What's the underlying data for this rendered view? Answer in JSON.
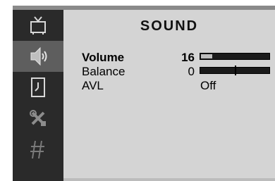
{
  "menu": {
    "title": "SOUND",
    "icons": [
      "tv-icon",
      "speaker-icon",
      "clock-icon",
      "tools-icon",
      "antenna-icon"
    ],
    "active_icon_index": 1
  },
  "settings": {
    "volume": {
      "label": "Volume",
      "value": "16",
      "level_fraction": 0.16
    },
    "balance": {
      "label": "Balance",
      "value": "0",
      "center_fraction": 0.5
    },
    "avl": {
      "label": "AVL",
      "value": "Off"
    }
  }
}
